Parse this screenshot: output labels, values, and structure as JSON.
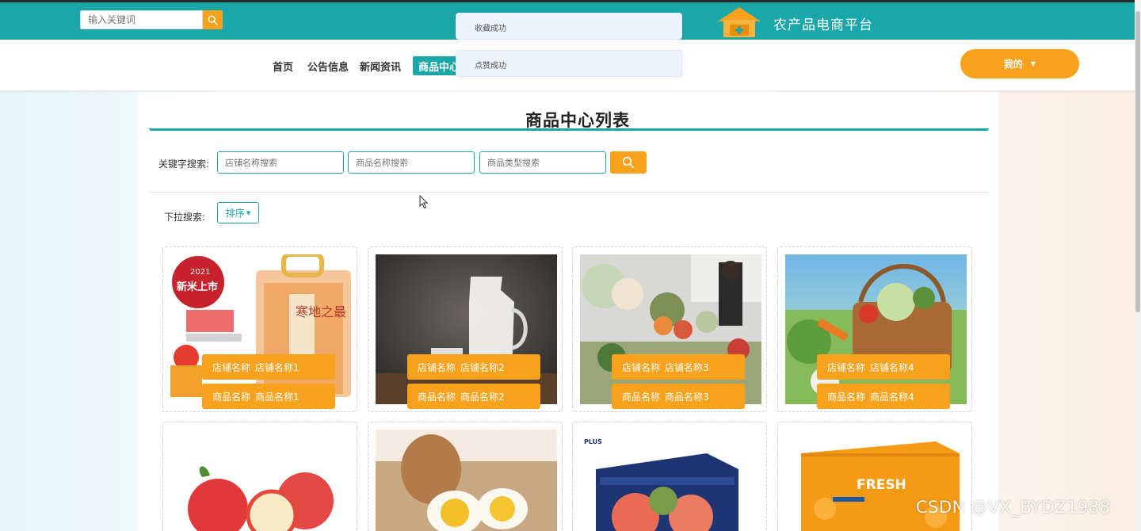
{
  "header": {
    "search_placeholder": "输入关键词",
    "site_title": "农产品电商平台",
    "accent_color": "#1aa7a9",
    "orange_color": "#f7a11d"
  },
  "nav": {
    "items": [
      "首页",
      "公告信息",
      "新闻资讯"
    ],
    "active": "商品中心",
    "user_menu": "我的"
  },
  "toasts": [
    "收藏成功",
    "点赞成功"
  ],
  "main": {
    "title": "商品中心列表",
    "keyword_label": "关键字搜索:",
    "inputs": {
      "shop_placeholder": "店铺名称搜索",
      "product_placeholder": "商品名称搜索",
      "type_placeholder": "商品类型搜索"
    },
    "dropdown_label": "下拉搜索:",
    "sort_label": "排序"
  },
  "products": [
    {
      "shop_key": "店铺名称",
      "shop_name": "店铺名称1",
      "product_key": "商品名称",
      "product_name": "商品名称1",
      "image": "rice-bag-image"
    },
    {
      "shop_key": "店铺名称",
      "shop_name": "店铺名称2",
      "product_key": "商品名称",
      "product_name": "商品名称2",
      "image": "milk-jug-image"
    },
    {
      "shop_key": "店铺名称",
      "shop_name": "店铺名称3",
      "product_key": "商品名称",
      "product_name": "商品名称3",
      "image": "vegetable-market-image"
    },
    {
      "shop_key": "店铺名称",
      "shop_name": "店铺名称4",
      "product_key": "商品名称",
      "product_name": "商品名称4",
      "image": "vegetable-basket-image"
    }
  ],
  "product_row2_images": [
    "apple-image",
    "egg-image",
    "fruit-box-image",
    "orange-box-image"
  ],
  "image_text": {
    "rice_badge_year": "2021",
    "rice_badge_text": "新米上市",
    "rice_bag_text": "寒地之最",
    "fresh_box_text": "FRESH",
    "plus_box_text": "PLUS"
  },
  "watermark": "CSDN @VX_BYDZ1988"
}
